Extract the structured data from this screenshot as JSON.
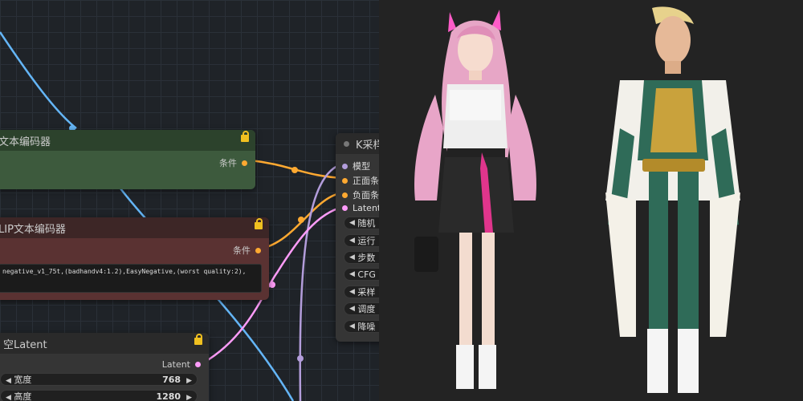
{
  "nodes": {
    "positive": {
      "title": "文本编码器",
      "output": "条件"
    },
    "negative": {
      "title": "LIP文本编码器",
      "output": "条件",
      "text": "negative_v1_75t,(badhandv4:1.2),EasyNegative,(worst quality:2),"
    },
    "latent": {
      "title": "空Latent",
      "output": "Latent",
      "widgets": [
        {
          "label": "宽度",
          "value": "768"
        },
        {
          "label": "高度",
          "value": "1280"
        }
      ]
    },
    "sampler": {
      "title": "K采样",
      "inputs": [
        "模型",
        "正面条件",
        "负面条件",
        "Latent"
      ],
      "widgets": [
        "随机",
        "运行",
        "步数",
        "CFG",
        "采样",
        "调度",
        "降噪"
      ]
    }
  },
  "colors": {
    "model_wire": "#b39ddb",
    "conditioning_wire": "#ffa931",
    "latent_wire": "#ff9cf9",
    "clip_wire": "#64b5f6",
    "positive_node": "#2f4a2f",
    "negative_node": "#4a2a2a"
  },
  "images": [
    "female-character-art",
    "male-character-art"
  ]
}
